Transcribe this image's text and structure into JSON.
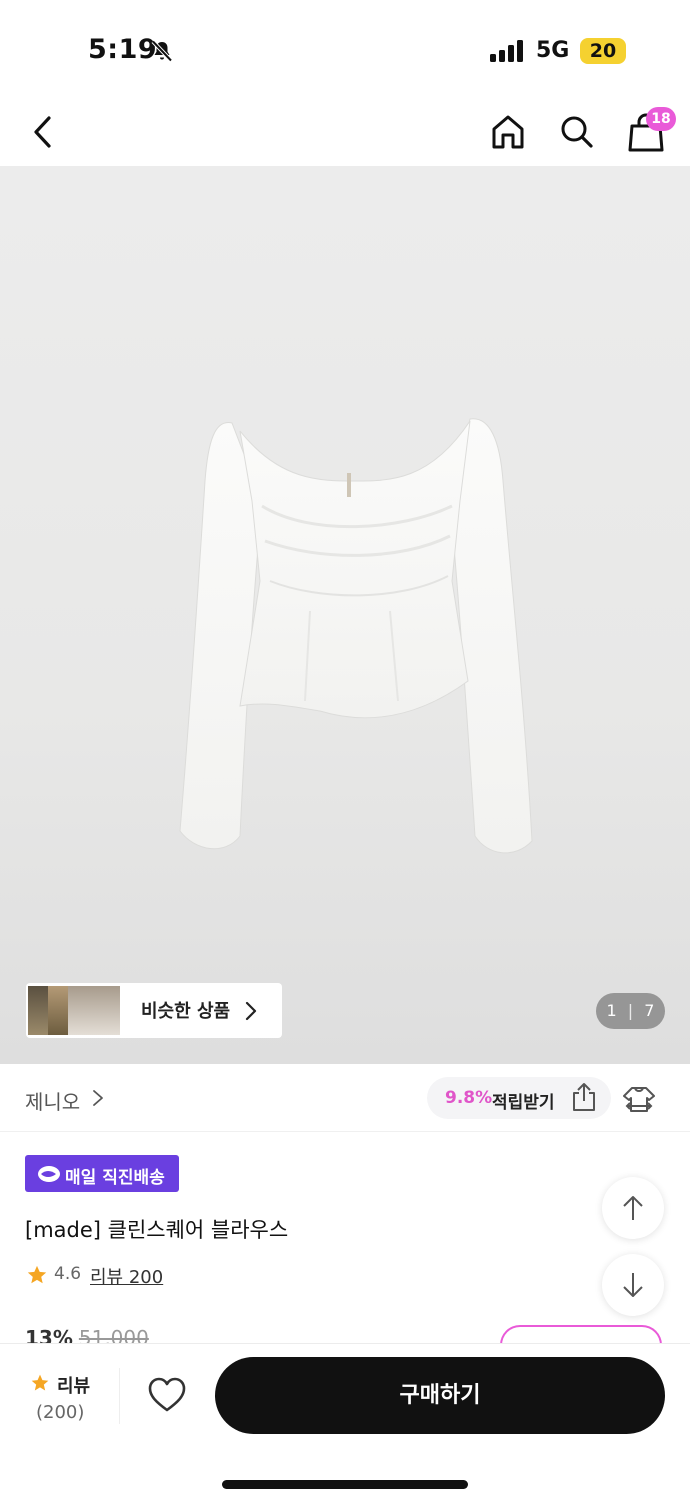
{
  "status_bar": {
    "time": "5:19",
    "network": "5G",
    "battery": "20"
  },
  "header": {
    "cart_count": "18"
  },
  "gallery": {
    "similar_label": "비슷한 상품",
    "current": "1",
    "separator": "|",
    "total": "7"
  },
  "brand": {
    "name": "제니오",
    "reward_rate": "9.8%",
    "reward_label": "적립받기"
  },
  "product": {
    "delivery_badge": "매일 직진배송",
    "title": "[made] 클린스퀘어 블라우스",
    "rating": "4.6",
    "review_link": "리뷰 200",
    "discount": "13%",
    "original_price": "51,000"
  },
  "bottom_bar": {
    "review_label": "리뷰",
    "review_count": "(200)",
    "buy_label": "구매하기"
  },
  "colors": {
    "accent": "#e95ad8",
    "delivery": "#6a3fe0",
    "buy": "#111111"
  }
}
